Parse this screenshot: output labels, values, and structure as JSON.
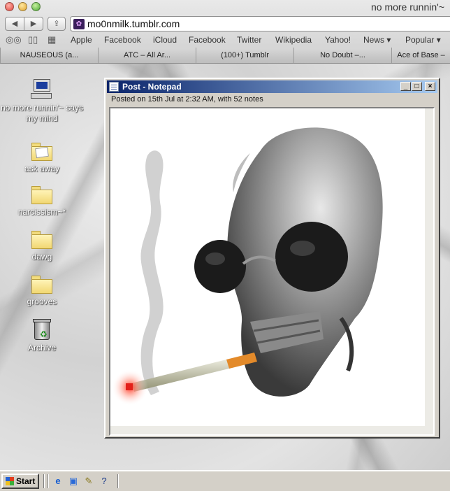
{
  "browser": {
    "window_title": "no more runnin'~",
    "url": "mo0nmilk.tumblr.com",
    "bookmarks": [
      "Apple",
      "Facebook",
      "iCloud",
      "Facebook",
      "Twitter",
      "Wikipedia",
      "Yahoo!",
      "News ▾",
      "Popular ▾"
    ],
    "tabs": [
      "NAUSEOUS (a...",
      "ATC – All Ar...",
      "(100+) Tumblr",
      "No Doubt –...",
      "Ace of Base –"
    ]
  },
  "desktop": {
    "icons": [
      {
        "label": "no more runnin'~ says my mind",
        "icon": "computer-icon"
      },
      {
        "label": "ask away",
        "icon": "open-folder-icon"
      },
      {
        "label": "narcissism~*",
        "icon": "folder-icon"
      },
      {
        "label": "dawg",
        "icon": "folder-icon"
      },
      {
        "label": "grooves",
        "icon": "folder-icon"
      },
      {
        "label": "Archive",
        "icon": "recycle-bin-icon"
      }
    ]
  },
  "notepad": {
    "title": "Post - Notepad",
    "meta": "Posted on 15th Jul at 2:32 AM, with 52 notes",
    "image": "skull-with-sunglasses-smoking-cigarette"
  },
  "taskbar": {
    "start_label": "Start",
    "quick_launch": [
      "internet-explorer-icon",
      "desktop-icon",
      "notepad-icon",
      "help-icon"
    ]
  }
}
